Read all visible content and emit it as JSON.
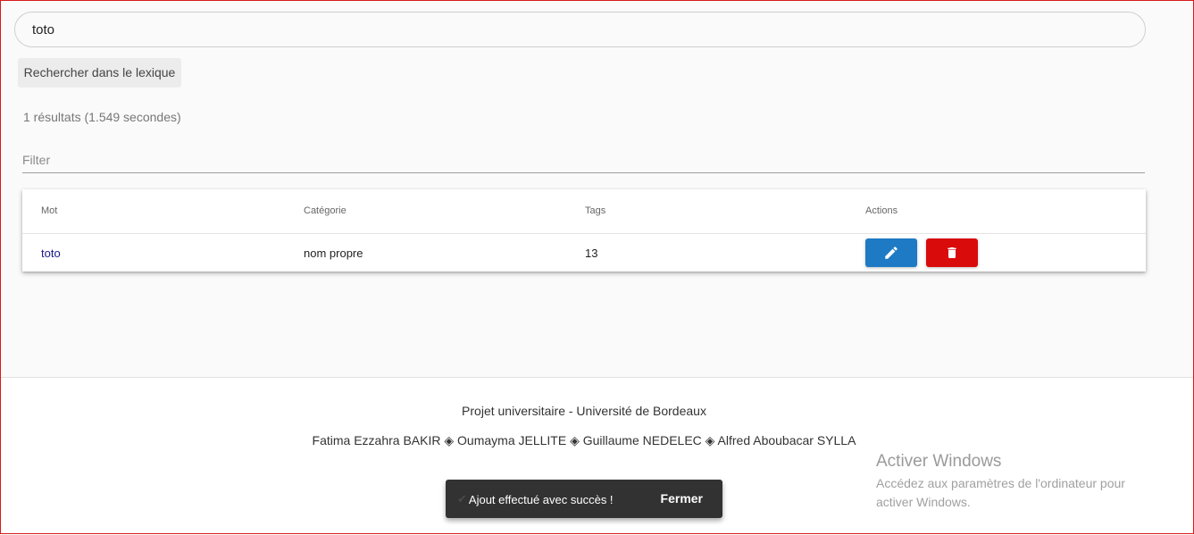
{
  "search": {
    "value": "toto"
  },
  "search_button_label": "Rechercher dans le lexique",
  "results_text": "1 résultats (1.549 secondes)",
  "filter": {
    "placeholder": "Filter"
  },
  "table": {
    "headers": [
      "Mot",
      "Catégorie",
      "Tags",
      "Actions"
    ],
    "rows": [
      {
        "mot": "toto",
        "categorie": "nom propre",
        "tags": "13"
      }
    ],
    "edit_icon": "pencil-icon",
    "delete_icon": "trash-icon"
  },
  "footer": {
    "line1": "Projet universitaire - Université de Bordeaux",
    "line2": "Fatima Ezzahra BAKIR ◈ Oumayma JELLITE ◈ Guillaume NEDELEC ◈ Alfred Aboubacar SYLLA"
  },
  "windows_watermark": {
    "title": "Activer Windows",
    "subtitle": "Accédez aux paramètres de l'ordinateur pour activer Windows."
  },
  "toast": {
    "message": "Ajout effectué avec succès !",
    "close_label": "Fermer"
  },
  "colors": {
    "edit_button": "#1e7ac4",
    "delete_button": "#d90b0b",
    "toast_bg": "#323232"
  }
}
